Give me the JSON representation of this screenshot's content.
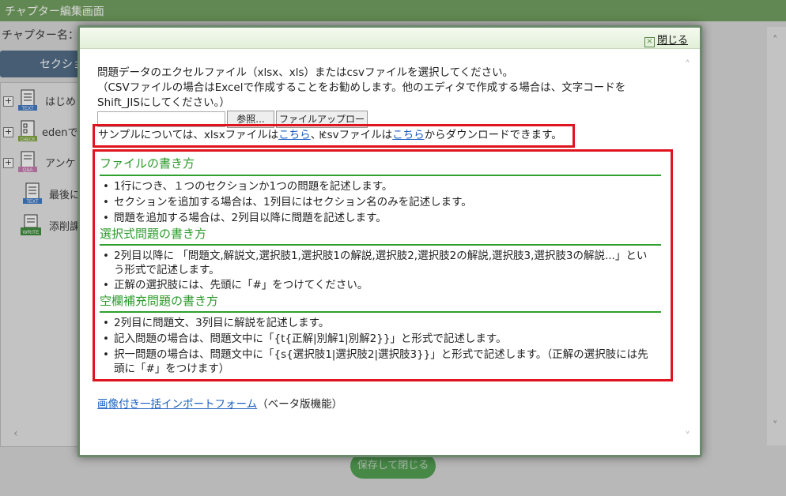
{
  "app": {
    "header_title": "チャプター編集画面",
    "chapter_label": "チャプター名：",
    "section_button": "セクショ",
    "tree_items": [
      {
        "label": "はじめ",
        "icon": "text-doc-icon",
        "badge": "TEXT",
        "badge_color": "#3b78c5",
        "expandable": true
      },
      {
        "label": "edenで",
        "icon": "check-doc-icon",
        "badge": "CHECK",
        "badge_color": "#7ea63b",
        "expandable": true
      },
      {
        "label": "アンケ",
        "icon": "qa-doc-icon",
        "badge": "Q&A",
        "badge_color": "#c77bb0",
        "expandable": true
      },
      {
        "label": "最後に",
        "icon": "text-doc-icon",
        "badge": "TEXT",
        "badge_color": "#3b78c5",
        "expandable": false
      },
      {
        "label": "添削課",
        "icon": "write-icon",
        "badge": "WRITE",
        "badge_color": "#3a8a3a",
        "expandable": false
      }
    ],
    "save_close_button": "保存して閉じる"
  },
  "modal": {
    "close_label": "閉じる",
    "intro_line1": "問題データのエクセルファイル（xlsx、xls）またはcsvファイルを選択してください。",
    "intro_line2": "（CSVファイルの場合はExcelで作成することをお勧めします。他のエディタで作成する場合は、文字コードを",
    "intro_line3": "Shift_JISにしてください。）",
    "browse_button": "参照...",
    "upload_button": "ファイルアップロード",
    "sample": {
      "text_a": "サンプルについては、xlsxファイルは",
      "link1": "こちら",
      "text_b": "、csvファイルは",
      "link2": "こちら",
      "text_c": "からダウンロードできます。"
    },
    "sections": [
      {
        "title": "ファイルの書き方",
        "bullets": [
          "1行につき、１つのセクションか1つの問題を記述します。",
          "セクションを追加する場合は、1列目にはセクション名のみを記述します。",
          "問題を追加する場合は、2列目以降に問題を記述します。"
        ]
      },
      {
        "title": "選択式問題の書き方",
        "bullets": [
          "2列目以降に 「問題文,解説文,選択肢1,選択肢1の解説,選択肢2,選択肢2の解説,選択肢3,選択肢3の解説...」という形式で記述します。",
          "正解の選択肢には、先頭に「#」をつけてください。"
        ]
      },
      {
        "title": "空欄補充問題の書き方",
        "bullets": [
          "2列目に問題文、3列目に解説を記述します。",
          "記入問題の場合は、問題文中に「{t{正解|別解1|別解2}}」と形式で記述します。",
          "択一問題の場合は、問題文中に「{s{選択肢1|選択肢2|選択肢3}}」と形式で記述します。（正解の選択肢には先頭に「#」をつけます）"
        ]
      }
    ],
    "import_link": "画像付き一括インポートフォーム",
    "import_note": "（ベータ版機能）"
  }
}
